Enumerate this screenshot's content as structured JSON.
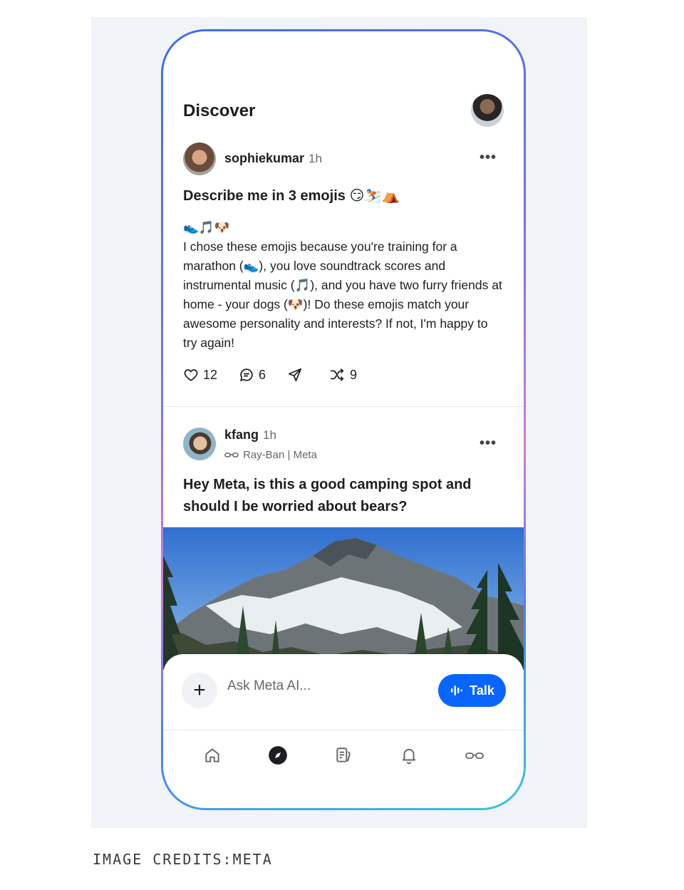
{
  "screen": {
    "title": "Discover"
  },
  "posts": [
    {
      "username": "sophiekumar",
      "time": "1h",
      "more": "•••",
      "headline": "Describe me in 3 emojis 😏⛷️⛺",
      "emoji_line": "👟🎵🐶",
      "body": "I chose these emojis because you're training for a marathon (👟), you love soundtrack scores and instrumental music (🎵), and you have two furry friends at home - your dogs (🐶)! Do these emojis match your awesome personality and interests? If not, I'm happy to try again!",
      "likes": "12",
      "comments": "6",
      "remixes": "9"
    },
    {
      "username": "kfang",
      "time": "1h",
      "more": "•••",
      "source": "Ray-Ban | Meta",
      "headline": "Hey Meta, is this a good camping spot and should I be worried about bears?"
    }
  ],
  "composer": {
    "plus": "+",
    "placeholder": "Ask Meta AI...",
    "talk_label": "Talk"
  },
  "nav": [
    "home-icon",
    "discover-icon",
    "library-icon",
    "notifications-icon",
    "glasses-icon"
  ],
  "accent_color": "#0866ff",
  "credit": "IMAGE CREDITS:META"
}
